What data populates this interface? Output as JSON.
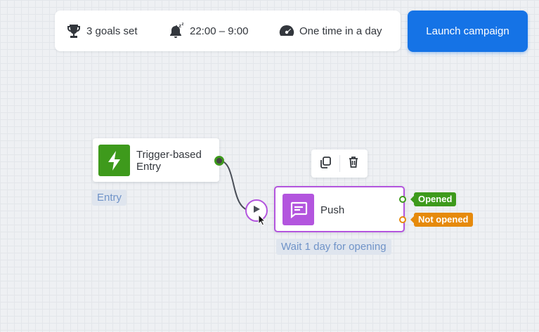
{
  "settings": {
    "goals": {
      "icon": "trophy-icon",
      "label": "3 goals set"
    },
    "quiet_hours": {
      "icon": "sleep-bell-icon",
      "label": "22:00 – 9:00"
    },
    "frequency": {
      "icon": "speedometer-icon",
      "label": "One time in a day"
    }
  },
  "launch_button": {
    "label": "Launch campaign",
    "color": "#1573e6"
  },
  "nodes": {
    "trigger": {
      "icon": "lightning-icon",
      "title": "Trigger-based Entry",
      "caption": "Entry",
      "color": "#3e9a1c"
    },
    "push": {
      "icon": "message-icon",
      "title": "Push",
      "caption": "Wait 1 day for opening",
      "color": "#b355de",
      "outputs": [
        {
          "label": "Opened",
          "color": "#3e9a1c"
        },
        {
          "label": "Not opened",
          "color": "#e68a0c"
        }
      ]
    }
  },
  "node_toolbar": {
    "actions": [
      {
        "icon": "copy-icon"
      },
      {
        "icon": "trash-icon"
      }
    ]
  }
}
